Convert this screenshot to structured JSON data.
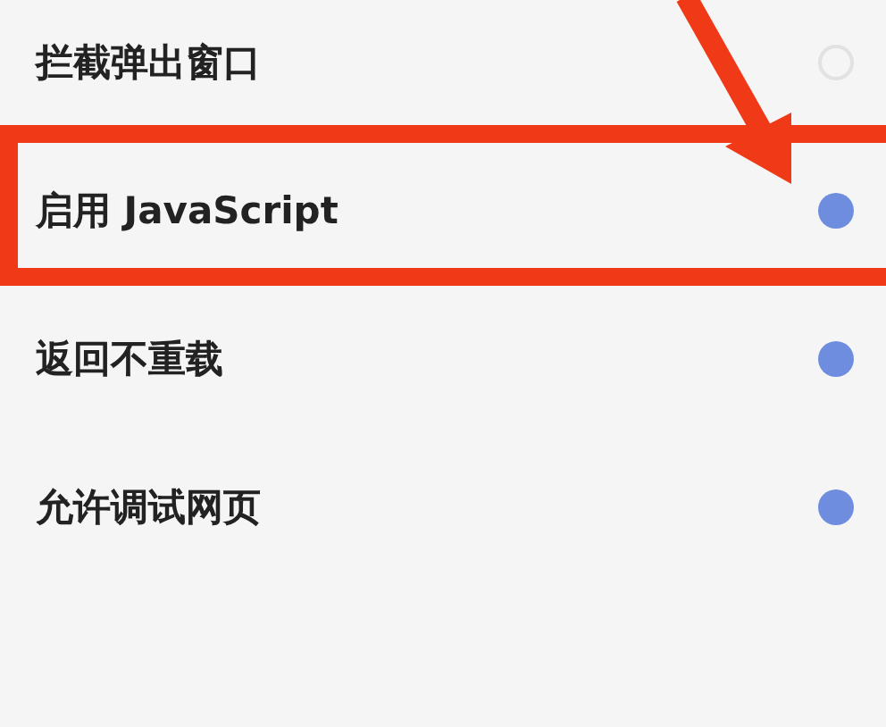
{
  "settings": [
    {
      "label": "拦截弹出窗口",
      "on": false,
      "highlighted": false
    },
    {
      "label": "启用 JavaScript",
      "on": true,
      "highlighted": true
    },
    {
      "label": "返回不重载",
      "on": true,
      "highlighted": false
    },
    {
      "label": "允许调试网页",
      "on": true,
      "highlighted": false
    }
  ]
}
